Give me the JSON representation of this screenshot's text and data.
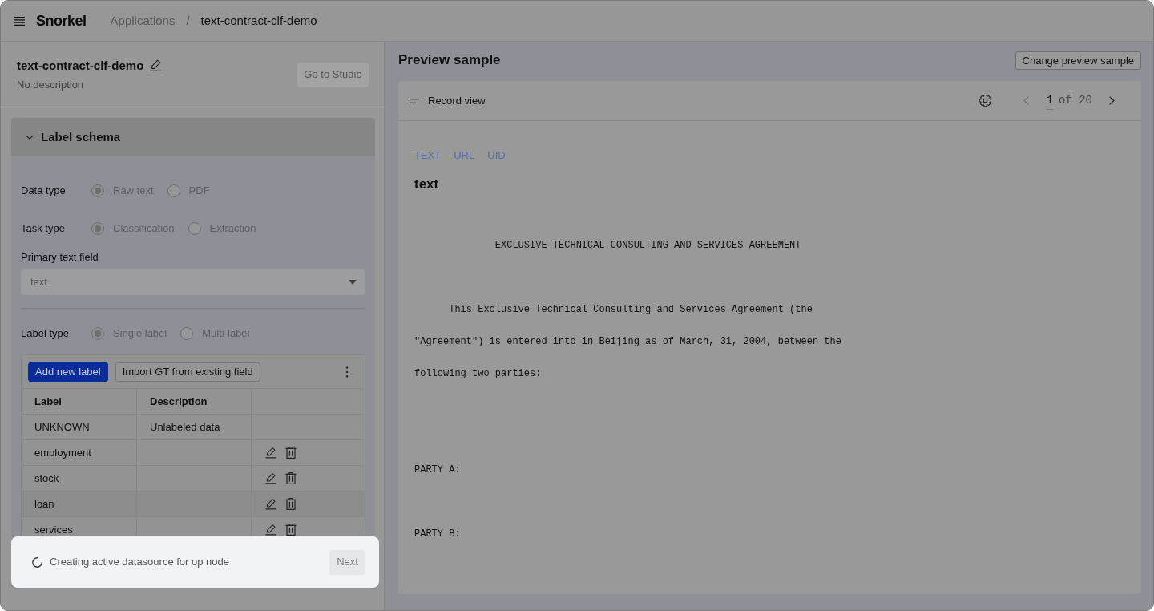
{
  "header": {
    "logo": "Snorkel",
    "separator": "/",
    "breadcrumbs": [
      {
        "label": "Applications",
        "current": false
      },
      {
        "label": "text-contract-clf-demo",
        "current": true
      }
    ]
  },
  "application": {
    "name": "text-contract-clf-demo",
    "description": "No description",
    "studio_button": {
      "label": "Go to Studio",
      "disabled": true
    }
  },
  "label_schema": {
    "title": "Label schema",
    "expanded": true,
    "fields": [
      {
        "kind": "radio",
        "label": "Data type",
        "disabled": true,
        "options": [
          {
            "label": "Raw text",
            "selected": true
          },
          {
            "label": "PDF",
            "selected": false
          }
        ]
      },
      {
        "kind": "radio",
        "label": "Task type",
        "disabled": true,
        "options": [
          {
            "label": "Classification",
            "selected": true
          },
          {
            "label": "Extraction",
            "selected": false
          }
        ]
      },
      {
        "kind": "select",
        "label": "Primary text field",
        "value": "text",
        "disabled": true
      },
      {
        "kind": "divider"
      },
      {
        "kind": "radio",
        "label": "Label type",
        "disabled": true,
        "options": [
          {
            "label": "Single label",
            "selected": true
          },
          {
            "label": "Multi-label",
            "selected": false
          }
        ]
      }
    ],
    "labels_table": {
      "buttons": [
        {
          "label": "Add new label",
          "kind": "primary"
        },
        {
          "label": "Import GT from existing field",
          "kind": "outline"
        }
      ],
      "columns": [
        "Label",
        "Description"
      ],
      "rows": [
        {
          "label": "UNKNOWN",
          "description": "Unlabeled data",
          "editable": false,
          "highlighted": false
        },
        {
          "label": "employment",
          "editable": true,
          "highlighted": false
        },
        {
          "label": "stock",
          "editable": true,
          "highlighted": false
        },
        {
          "label": "loan",
          "editable": true,
          "highlighted": true
        },
        {
          "label": "services",
          "editable": true,
          "highlighted": false
        }
      ]
    }
  },
  "loading_panel": {
    "message": "Creating active datasource for op node",
    "next_button": {
      "label": "Next",
      "disabled": true
    }
  },
  "preview": {
    "title": "Preview sample",
    "change_button": "Change preview sample",
    "record_view": {
      "title": "Record view",
      "page": "1",
      "of_text": "of 20",
      "prev_disabled": true,
      "next_disabled": false
    },
    "field_links": [
      "TEXT",
      "URL",
      "UID"
    ],
    "field_title": "text",
    "document": "              EXCLUSIVE TECHNICAL CONSULTING AND SERVICES AGREEMENT\n\n\n\n      This Exclusive Technical Consulting and Services Agreement (the\n\n\"Agreement\") is entered into in Beijing as of March, 31, 2004, between the\n\nfollowing two parties:\n\n\n\n\n\nPARTY A:\n\n\n\nPARTY B:"
  }
}
